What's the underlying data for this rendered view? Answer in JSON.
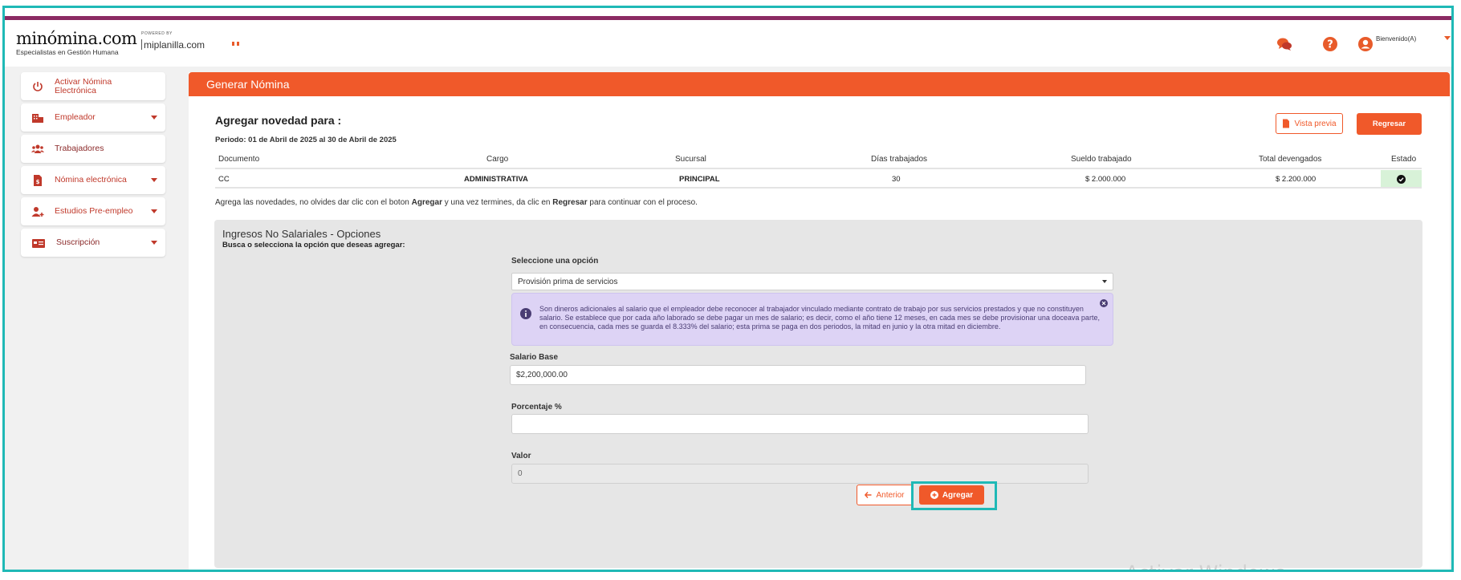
{
  "colors": {
    "accent": "#f0592a",
    "topline": "#8b2a63",
    "highlight": "#1fb9b6",
    "info_bg": "#ddd3f5",
    "estado_bg": "#d8f2d8"
  },
  "header": {
    "logo_main": "minómina.com",
    "logo_sub": "Especialistas en Gestión Humana",
    "powered_by": "POWERED BY",
    "miplanilla": "miplanilla.com",
    "icons": [
      "chat-icon",
      "help-icon",
      "user-icon"
    ],
    "welcome": "Bienvenido(A)"
  },
  "sidebar": {
    "items": [
      {
        "label": "Activar Nómina Electrónica",
        "icon": "power-icon",
        "has_caret": false
      },
      {
        "label": "Empleador",
        "icon": "building-icon",
        "has_caret": true
      },
      {
        "label": "Trabajadores",
        "icon": "users-icon",
        "has_caret": false
      },
      {
        "label": "Nómina electrónica",
        "icon": "document-icon",
        "has_caret": true
      },
      {
        "label": "Estudios Pre-empleo",
        "icon": "user-plus-icon",
        "has_caret": true
      },
      {
        "label": "Suscripción",
        "icon": "card-icon",
        "has_caret": true
      }
    ]
  },
  "main": {
    "title": "Generar Nómina",
    "heading": "Agregar novedad para :",
    "period": "Periodo: 01 de Abril de 2025 al 30 de Abril de 2025",
    "preview_button": "Vista previa",
    "back_button": "Regresar",
    "table": {
      "columns": [
        "Documento",
        "Cargo",
        "Sucursal",
        "Días trabajados",
        "Sueldo trabajado",
        "Total devengados",
        "Estado"
      ],
      "row": [
        "CC",
        "ADMINISTRATIVA",
        "PRINCIPAL",
        "30",
        "$ 2.000.000",
        "$ 2.200.000",
        ""
      ]
    },
    "instructions_pre": "Agrega las novedades, no olvides dar clic con el boton ",
    "instructions_bold1": "Agregar",
    "instructions_mid": " y una vez termines, da clic en ",
    "instructions_bold2": "Regresar",
    "instructions_post": " para continuar con el proceso.",
    "panel": {
      "title": "Ingresos No Salariales - Opciones",
      "subtitle": "Busca o selecciona la opción que deseas agregar:",
      "select_label": "Seleccione una opción",
      "select_value": "Provisión prima de servicios",
      "info_text": "Son dineros adicionales al salario que el empleador debe reconocer al trabajador vinculado mediante contrato de trabajo por sus servicios prestados y que no constituyen salario. Se establece que por cada año laborado se debe pagar un mes de salario; es decir, como el año tiene 12 meses, en cada mes se debe provisionar una doceava parte, en consecuencia, cada mes se guarda el 8.333% del salario; esta prima se paga en dos periodos, la mitad en junio y la otra mitad en diciembre.",
      "salario_label": "Salario Base",
      "salario_value": "$2,200,000.00",
      "porcentaje_label": "Porcentaje %",
      "porcentaje_value": "",
      "valor_label": "Valor",
      "valor_value": "0",
      "anterior_button": "Anterior",
      "agregar_button": "Agregar"
    }
  },
  "watermark": "Activar Windows"
}
